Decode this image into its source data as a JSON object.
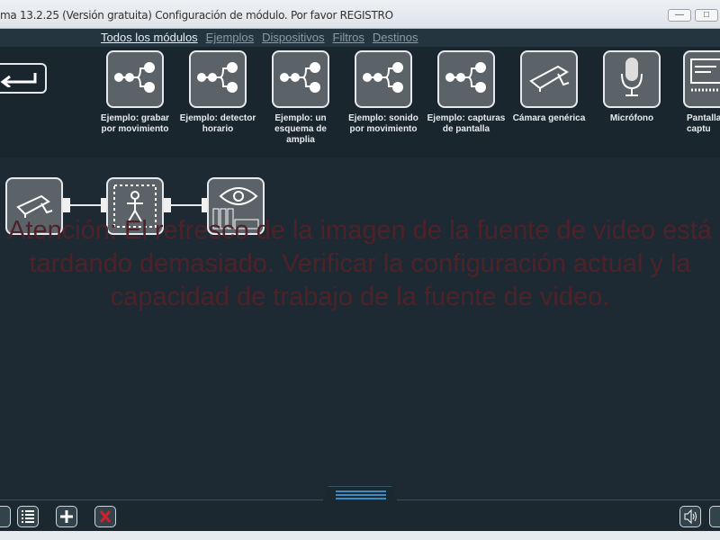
{
  "window": {
    "title": "ma 13.2.25 (Versión gratuita) Configuración de módulo. Por favor REGISTRO",
    "minimize": "—",
    "maximize": "□"
  },
  "nav": {
    "tabs": [
      {
        "label": "Todos los módulos",
        "active": true
      },
      {
        "label": "Ejemplos"
      },
      {
        "label": "Dispositivos"
      },
      {
        "label": "Filtros"
      },
      {
        "label": "Destinos"
      }
    ]
  },
  "modules": [
    {
      "label": "Ejemplo: grabar por movimiento",
      "icon": "scheme-icon"
    },
    {
      "label": "Ejemplo: detector horario",
      "icon": "scheme-icon"
    },
    {
      "label": "Ejemplo: un esquema de amplia",
      "icon": "scheme-icon"
    },
    {
      "label": "Ejemplo: sonido por movimiento",
      "icon": "scheme-icon"
    },
    {
      "label": "Ejemplo: capturas de pantalla",
      "icon": "scheme-icon"
    },
    {
      "label": "Cámara genérica",
      "icon": "camera-icon"
    },
    {
      "label": "Micrófono",
      "icon": "microphone-icon"
    },
    {
      "label": "Pantalla captu",
      "icon": "screen-capture-icon"
    }
  ],
  "pipeline": [
    "camera",
    "motion-detector",
    "viewer"
  ],
  "warning": "Atención: El refresco de la imagen de la fuente de video está tardando demasiado. Verificar la configuración actual y la capacidad de trabajo de la fuente de video.",
  "colors": {
    "warning": "#4e2228",
    "accent": "#3b8cc4",
    "delete": "#d0202a"
  }
}
